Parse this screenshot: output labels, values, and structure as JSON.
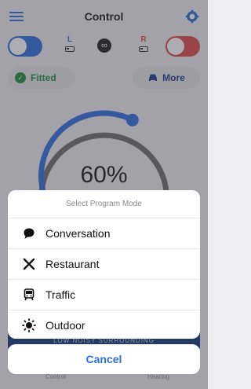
{
  "header": {
    "title": "Control"
  },
  "devices": {
    "left_label": "L",
    "right_label": "R",
    "left_color": "#2f6fe0",
    "right_color": "#e14b4b"
  },
  "status": {
    "fitted_label": "Fitted",
    "more_label": "More"
  },
  "volume": {
    "percent_text": "60%",
    "level": 0.6
  },
  "background_button": {
    "label": "LOW NOISY SURROUNDING"
  },
  "tabs": {
    "control": "Control",
    "hearing": "Hearing"
  },
  "program_sheet": {
    "title": "Select Program Mode",
    "options": [
      {
        "icon": "speech-bubble-icon",
        "label": "Conversation"
      },
      {
        "icon": "fork-knife-icon",
        "label": "Restaurant"
      },
      {
        "icon": "train-icon",
        "label": "Traffic"
      },
      {
        "icon": "sun-icon",
        "label": "Outdoor"
      }
    ],
    "cancel_label": "Cancel"
  },
  "colors": {
    "accent": "#2f6fe0",
    "fitted": "#1e8e3e",
    "dark_bar": "#123a7a"
  }
}
